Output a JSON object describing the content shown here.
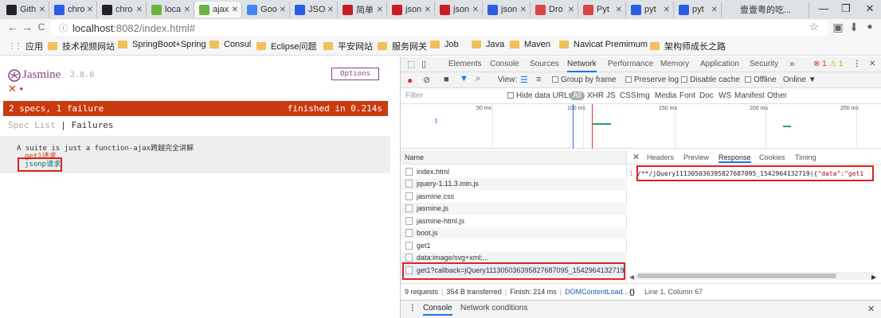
{
  "tabs": [
    {
      "label": "Gith",
      "icon": "github-icon",
      "color": "#222"
    },
    {
      "label": "chro",
      "icon": "baidu-paw-icon",
      "color": "#2b5ce6"
    },
    {
      "label": "chro",
      "icon": "github-icon",
      "color": "#222"
    },
    {
      "label": "loca",
      "icon": "spring-leaf-icon",
      "color": "#6db33f"
    },
    {
      "label": "ajax",
      "icon": "spring-leaf-icon",
      "color": "#6db33f"
    },
    {
      "label": "Goo",
      "icon": "google-icon",
      "color": "#4285f4"
    },
    {
      "label": "JSO",
      "icon": "baidu-paw-icon",
      "color": "#2b5ce6"
    },
    {
      "label": "简单",
      "icon": "csdn-icon",
      "color": "#c71d23"
    },
    {
      "label": "json",
      "icon": "csdn-icon",
      "color": "#c71d23"
    },
    {
      "label": "json",
      "icon": "csdn-icon",
      "color": "#c71d23"
    },
    {
      "label": "json",
      "icon": "baidu-paw-icon",
      "color": "#2b5ce6"
    },
    {
      "label": "Dro",
      "icon": "red-icon",
      "color": "#d44"
    },
    {
      "label": "Pyt",
      "icon": "red-icon",
      "color": "#d44"
    },
    {
      "label": "pyt",
      "icon": "baidu-paw-icon",
      "color": "#2b5ce6"
    },
    {
      "label": "pyt",
      "icon": "baidu-paw-icon",
      "color": "#2b5ce6"
    },
    {
      "label": "壹壹粤的吃...",
      "icon": "blank-icon",
      "color": "#dee1e6"
    }
  ],
  "window": {
    "minimize": "—",
    "maximize": "❐",
    "close": "✕"
  },
  "toolbar": {
    "back": "←",
    "forward": "→",
    "reload": "C",
    "url_host": "localhost",
    "url_rest": ":8082/index.html#",
    "info_icon": "ⓘ"
  },
  "bookmarks": [
    {
      "label": "应用",
      "icon": "apps-icon"
    },
    {
      "label": "技术视频网站",
      "icon": "folder-icon"
    },
    {
      "label": "SpringBoot+Spring",
      "icon": "folder-icon"
    },
    {
      "label": "Consul",
      "icon": "folder-icon"
    },
    {
      "label": "Eclipse问题",
      "icon": "folder-icon"
    },
    {
      "label": "平安网站",
      "icon": "folder-icon"
    },
    {
      "label": "服务网关",
      "icon": "folder-icon"
    },
    {
      "label": "Job",
      "icon": "folder-icon"
    },
    {
      "label": "Java",
      "icon": "folder-icon"
    },
    {
      "label": "Maven",
      "icon": "folder-icon"
    },
    {
      "label": "Navicat Premimum",
      "icon": "folder-icon"
    },
    {
      "label": "架构师成长之路",
      "icon": "folder-icon"
    }
  ],
  "jasmine": {
    "brand": "Jasmine",
    "version": "2.8.0",
    "options": "Options",
    "symbols": "✕ •",
    "summary": "2 specs, 1 failure",
    "finished": "finished in 0.214s",
    "spec_list": "Spec List",
    "separator": "|",
    "failures": "Failures",
    "suite": "A suite is just a function-ajax跨越完全讲解",
    "spec_get1": "get1请求",
    "spec_jsonp": "jsonp请求",
    "colors": {
      "fail": "#ca3a11",
      "pass": "#007069",
      "brand": "#8a4182"
    }
  },
  "devtools": {
    "tabs": [
      "Elements",
      "Console",
      "Sources",
      "Network",
      "Performance",
      "Memory",
      "Application",
      "Security"
    ],
    "active_tab": "Network",
    "more": "»",
    "errors": "1",
    "warnings": "1",
    "toolbar": {
      "view": "View:",
      "group_by_frame": "Group by frame",
      "preserve_log": "Preserve log",
      "disable_cache": "Disable cache",
      "offline": "Offline",
      "online": "Online"
    },
    "filter": {
      "placeholder": "Filter",
      "hide_data_urls": "Hide data URLs",
      "types": [
        "All",
        "XHR",
        "JS",
        "CSS",
        "Img",
        "Media",
        "Font",
        "Doc",
        "WS",
        "Manifest",
        "Other"
      ]
    },
    "timeline": {
      "ticks": [
        "50 ms",
        "100 ms",
        "150 ms",
        "200 ms",
        "250 ms"
      ]
    },
    "name_header": "Name",
    "requests": [
      "index.html",
      "jquery-1.11.3.min.js",
      "jasmine.css",
      "jasmine.js",
      "jasmine-html.js",
      "boot.js",
      "get1",
      "data:image/svg+xml;...",
      "get1?callback=jQuery111305036395827687095_1542964132719"
    ],
    "detail_tabs": [
      "Headers",
      "Preview",
      "Response",
      "Cookies",
      "Timing"
    ],
    "active_detail": "Response",
    "close": "✕",
    "line_number": "1",
    "response_text": "/**/jQuery111305036395827687095_1542964132719({\"data\":\"get1",
    "status": {
      "requests": "9 requests",
      "transferred": "354 B transferred",
      "finish": "Finish: 214 ms",
      "dcl": "DOMContentLoad..."
    },
    "position": "Line 1, Column 67",
    "braces": "{}",
    "drawer_tabs": [
      "Console",
      "Network conditions"
    ],
    "drawer_menu": "⋮"
  }
}
